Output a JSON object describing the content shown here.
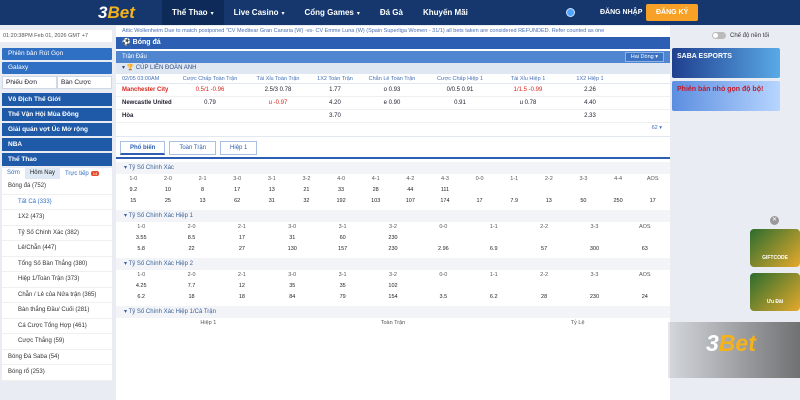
{
  "brand": {
    "logo_num": "3",
    "logo_word": "Bet"
  },
  "nav": {
    "items": [
      "Thể Thao",
      "Live Casino",
      "Cổng Games",
      "Đá Gà",
      "Khuyến Mãi"
    ]
  },
  "auth": {
    "login": "ĐĂNG NHẬP",
    "register": "ĐĂNG KÝ"
  },
  "datetime": "01:20:38PM Feb 01, 2026 GMT +7",
  "mode_toggle": "Chế độ nền tối",
  "marquee": "Attic Wollenheim Due to match postponed \"CV Meditear Gran Canaria (W) -vs- CV Emme Luna (W) (Spain Superliga Women - 31/1) all bets taken are considered REFUNDED. Refer counted as one",
  "sidebar": {
    "blue_buttons": [
      "Phiên bản Rút Gọn",
      "Galaxy"
    ],
    "filter_tabs": [
      "Phiếu Đơn",
      "Bàn Cược"
    ],
    "categories": [
      "Vô Địch Thế Giới",
      "Thế Vận Hội Mùa Đông",
      "Giải quán vợt Úc Mở rộng",
      "NBA",
      "Thể Thao"
    ],
    "sub_tabs": [
      "Sớm",
      "Hôm Nay",
      "Trực tiếp"
    ],
    "new_badge": "14",
    "list": [
      {
        "label": "Bóng đá (752)",
        "head": true
      },
      {
        "label": "Tất Cả (333)",
        "sub": true
      },
      {
        "label": "1X2 (473)"
      },
      {
        "label": "Tỷ Số Chính Xác (382)"
      },
      {
        "label": "Lẻ/Chẵn (447)"
      },
      {
        "label": "Tổng Số Bàn Thắng (380)"
      },
      {
        "label": "Hiệp 1/Toàn Trận (373)"
      },
      {
        "label": "Chẵn / Lẻ của Nửa trận (365)"
      },
      {
        "label": "Bàn thắng Đầu/ Cuối (281)"
      },
      {
        "label": "Cá Cược Tổng Hợp (461)"
      },
      {
        "label": "Cược Thắng (59)"
      },
      {
        "label": "Bóng Đá Saba (54)",
        "head": true
      },
      {
        "label": "Bóng rổ (253)",
        "head": true
      }
    ]
  },
  "main": {
    "section": "Bóng đá",
    "tran_dau": "Trận Đấu",
    "sort": "Hai Dòng",
    "league": "CÚP LIÊN ĐOÀN ANH",
    "odds_headers": [
      "02/05 03:00AM",
      "Cược Chấp Toàn Trận",
      "Tài Xỉu Toàn Trận",
      "1X2 Toàn Trận",
      "Chẵn Lẻ Toàn Trận",
      "Cược Chấp Hiệp 1",
      "Tài Xỉu Hiệp 1",
      "1X2 Hiệp 1"
    ],
    "rows": [
      [
        "Manchester City",
        "0.5/1   -0.96",
        "2.5/3   0.78",
        "1.77",
        "o   0.93",
        "0/0.5   0.91",
        "1/1.5   -0.99",
        "2.26"
      ],
      [
        "Newcastle United",
        "0.79",
        "u   -0.97",
        "4.20",
        "e   0.90",
        "0.91",
        "u   0.78",
        "4.40"
      ],
      [
        "Hòa",
        "",
        "",
        "3.70",
        "",
        "",
        "",
        "2.33"
      ]
    ],
    "mini_count": "62",
    "tabs": [
      "Phổ biến",
      "Toàn Trận",
      "Hiệp 1"
    ],
    "blocks": [
      {
        "title": "Tỷ Số Chính Xác",
        "head": [
          "1-0",
          "2-0",
          "2-1",
          "3-0",
          "3-1",
          "3-2",
          "4-0",
          "4-1",
          "4-2",
          "4-3",
          "0-0",
          "1-1",
          "2-2",
          "3-3",
          "4-4",
          "AOS"
        ],
        "vals1": [
          "9.2",
          "10",
          "8",
          "17",
          "13",
          "21",
          "33",
          "28",
          "44",
          "111",
          "",
          "",
          "",
          "",
          "",
          ""
        ],
        "vals2": [
          "15",
          "25",
          "13",
          "62",
          "31",
          "32",
          "192",
          "103",
          "107",
          "174",
          "17",
          "7.9",
          "13",
          "50",
          "250",
          "17"
        ]
      },
      {
        "title": "Tỷ Số Chính Xác Hiệp 1",
        "head": [
          "1-0",
          "2-0",
          "2-1",
          "3-0",
          "3-1",
          "3-2",
          "0-0",
          "1-1",
          "2-2",
          "3-3",
          "AOS"
        ],
        "vals1": [
          "3.55",
          "8.5",
          "17",
          "31",
          "60",
          "230",
          "",
          "",
          "",
          "",
          ""
        ],
        "vals2": [
          "5.8",
          "22",
          "27",
          "130",
          "157",
          "230",
          "2.96",
          "6.9",
          "57",
          "300",
          "63"
        ]
      },
      {
        "title": "Tỷ Số Chính Xác Hiệp 2",
        "head": [
          "1-0",
          "2-0",
          "2-1",
          "3-0",
          "3-1",
          "3-2",
          "0-0",
          "1-1",
          "2-2",
          "3-3",
          "AOS"
        ],
        "vals1": [
          "4.25",
          "7.7",
          "12",
          "35",
          "35",
          "102",
          "",
          "",
          "",
          "",
          ""
        ],
        "vals2": [
          "6.2",
          "18",
          "18",
          "84",
          "79",
          "154",
          "3.5",
          "6.2",
          "28",
          "230",
          "24"
        ]
      },
      {
        "title": "Tỷ Số Chính Xác Hiệp 1/Cả Trận",
        "head": [
          "Hiệp 1",
          "Toàn Trận",
          "Tỷ Lệ"
        ],
        "vals1": [],
        "vals2": []
      }
    ]
  },
  "banners": [
    "SABA ESPORTS",
    "Phiên bản nhỏ gọn độ bộ!"
  ],
  "promos": [
    "GIFTCODE",
    "Ưu Đãi",
    "Ưu Đãi"
  ],
  "watermark": {
    "num": "3",
    "word": "Bet"
  }
}
